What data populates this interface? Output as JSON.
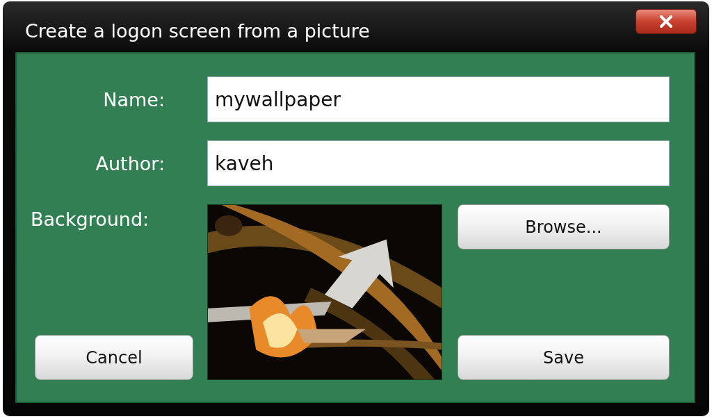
{
  "window": {
    "title": "Create a logon screen from a picture"
  },
  "fields": [
    {
      "label": "Name:",
      "value": "mywallpaper"
    },
    {
      "label": "Author:",
      "value": "kaveh"
    }
  ],
  "background": {
    "label": "Background:"
  },
  "buttons": {
    "browse": "Browse...",
    "cancel": "Cancel",
    "save": "Save"
  }
}
